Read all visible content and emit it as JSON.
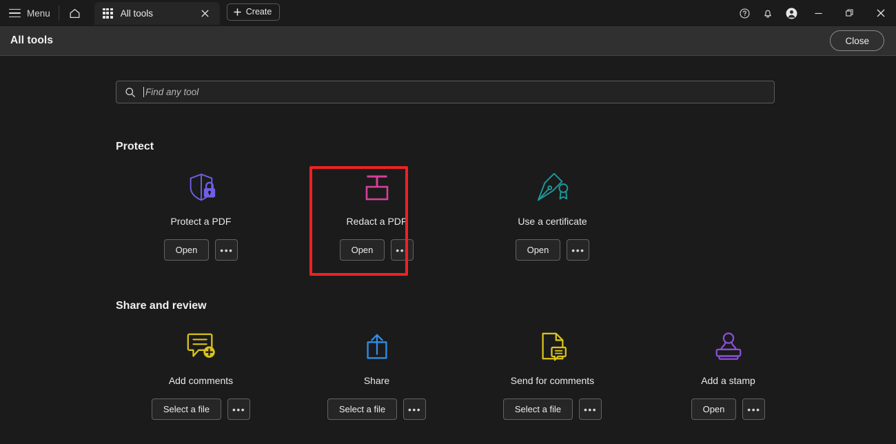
{
  "titlebar": {
    "menu_label": "Menu",
    "hamburger_icon": "hamburger-icon",
    "home_icon": "home-icon",
    "tab": {
      "icon": "grid-icon",
      "label": "All tools",
      "close_icon": "close-icon"
    },
    "create_label": "Create",
    "create_icon": "plus-icon",
    "help_icon": "help-circle-icon",
    "bell_icon": "bell-icon",
    "account_icon": "account-avatar-icon",
    "minimize_icon": "minimize-icon",
    "restore_icon": "restore-window-icon",
    "close_window_icon": "close-window-icon"
  },
  "header": {
    "title": "All tools",
    "close_label": "Close"
  },
  "search": {
    "placeholder": "Find any tool",
    "value": "",
    "icon": "search-icon"
  },
  "sections": [
    {
      "title": "Protect",
      "cards": [
        {
          "label": "Protect a PDF",
          "icon": "shield-lock-icon",
          "color": "#6F5FE8",
          "primary_label": "Open",
          "more_label": "•••",
          "highlighted": false
        },
        {
          "label": "Redact a PDF",
          "icon": "redact-marker-icon",
          "color": "#D4409A",
          "primary_label": "Open",
          "more_label": "•••",
          "highlighted": true
        },
        {
          "label": "Use a certificate",
          "icon": "certificate-pen-icon",
          "color": "#1B9A9A",
          "primary_label": "Open",
          "more_label": "•••",
          "highlighted": false
        }
      ]
    },
    {
      "title": "Share and review",
      "cards": [
        {
          "label": "Add comments",
          "icon": "comment-add-icon",
          "color": "#D9C21B",
          "primary_label": "Select a file",
          "more_label": "•••",
          "highlighted": false
        },
        {
          "label": "Share",
          "icon": "share-upload-icon",
          "color": "#2E8FE8",
          "primary_label": "Select a file",
          "more_label": "•••",
          "highlighted": false
        },
        {
          "label": "Send for comments",
          "icon": "document-comment-icon",
          "color": "#D9C21B",
          "primary_label": "Select a file",
          "more_label": "•••",
          "highlighted": false
        },
        {
          "label": "Add a stamp",
          "icon": "stamp-icon",
          "color": "#8A4FD8",
          "primary_label": "Open",
          "more_label": "•••",
          "highlighted": false
        }
      ]
    }
  ],
  "highlight": {
    "color": "#EE2222"
  }
}
